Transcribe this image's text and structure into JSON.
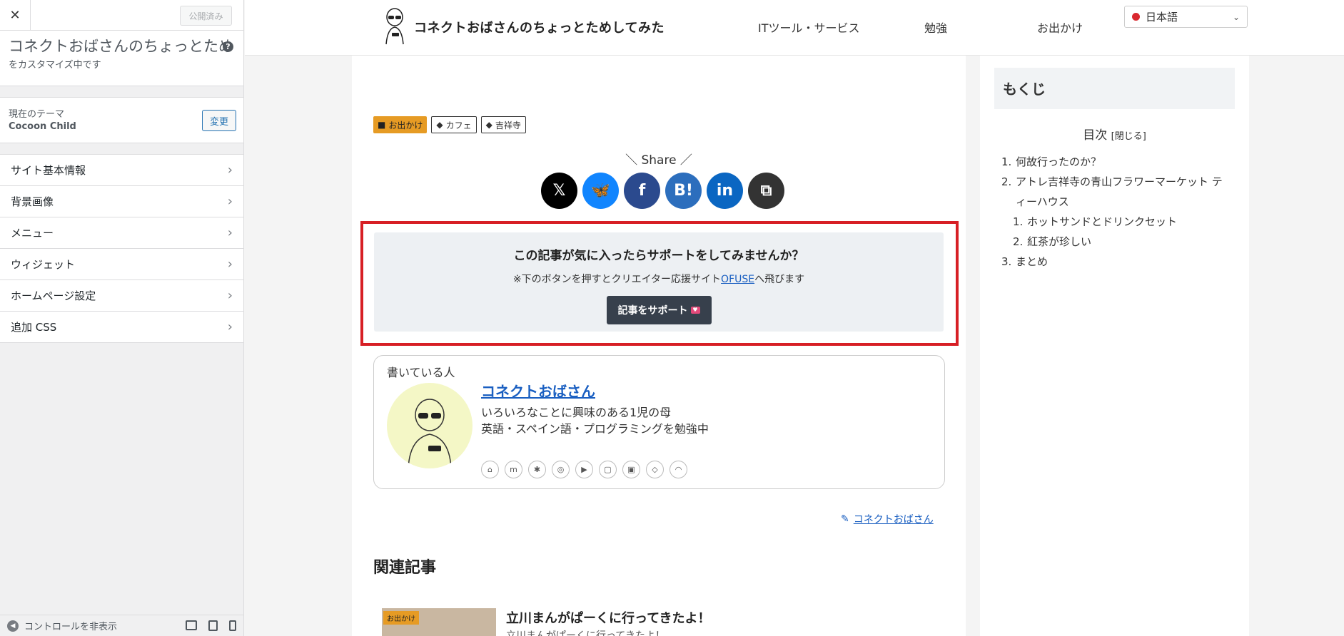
{
  "customizer": {
    "close_glyph": "✕",
    "publish_label": "公開済み",
    "site_title": "コネクトおばさんのちょっとため…",
    "subtitle": "をカスタマイズ中です",
    "help_glyph": "?",
    "theme_label": "現在のテーマ",
    "theme_name": "Cocoon Child",
    "change_label": "変更",
    "menu": [
      {
        "label": "サイト基本情報"
      },
      {
        "label": "背景画像"
      },
      {
        "label": "メニュー"
      },
      {
        "label": "ウィジェット"
      },
      {
        "label": "ホームページ設定"
      },
      {
        "label": "追加 CSS"
      }
    ],
    "hide_controls_label": "コントロールを非表示"
  },
  "header": {
    "site_title": "コネクトおばさんのちょっとためしてみた",
    "nav": [
      "ITツール・サービス",
      "勉強",
      "お出かけ"
    ],
    "language": "日本語"
  },
  "article": {
    "categories": [
      {
        "label": "お出かけ",
        "type": "folder"
      },
      {
        "label": "カフェ",
        "type": "tag"
      },
      {
        "label": "吉祥寺",
        "type": "tag"
      }
    ],
    "share_label": "＼ Share ／",
    "share_buttons": [
      {
        "name": "x",
        "glyph": "𝕏",
        "color": "#000000"
      },
      {
        "name": "bluesky",
        "glyph": "🦋",
        "color": "#1185fe"
      },
      {
        "name": "facebook",
        "glyph": "f",
        "color": "#2b4a8e"
      },
      {
        "name": "hatena",
        "glyph": "B!",
        "color": "#2c6ebd"
      },
      {
        "name": "linkedin",
        "glyph": "in",
        "color": "#0a66c2"
      },
      {
        "name": "copy",
        "glyph": "⧉",
        "color": "#333333"
      }
    ],
    "support": {
      "title": "この記事が気に入ったらサポートをしてみませんか？",
      "text_before": "※下のボタンを押すとクリエイター応援サイト",
      "link_text": "OFUSE",
      "text_after": "へ飛びます",
      "button_label": "記事をサポート",
      "highlight_color": "#d71f25"
    },
    "author": {
      "label": "書いている人",
      "name": "コネクトおばさん",
      "desc_line1": "いろいろなことに興味のある1児の母",
      "desc_line2": "英語・スペイン語・プログラミングを勉強中",
      "social_icons": [
        "home-icon",
        "mastodon-icon",
        "bluesky-icon",
        "instagram-icon",
        "youtube-icon",
        "note-icon",
        "twitch-icon",
        "feedly-icon",
        "rss-icon"
      ]
    },
    "author_link": "コネクトおばさん",
    "related_heading": "関連記事",
    "related": [
      {
        "title": "立川まんがぱーくに行ってきたよ！",
        "snippet": "立川まんがぱーくに行ってきたよ！",
        "badge": "お出かけ"
      }
    ]
  },
  "toc": {
    "heading": "もくじ",
    "title": "目次",
    "toggle": "[閉じる]",
    "items": [
      {
        "num": "1.",
        "label": "何故行ったのか？",
        "level": 1
      },
      {
        "num": "2.",
        "label": "アトレ吉祥寺の青山フラワーマーケット ティーハウス",
        "level": 1
      },
      {
        "num": "1.",
        "label": "ホットサンドとドリンクセット",
        "level": 2
      },
      {
        "num": "2.",
        "label": "紅茶が珍しい",
        "level": 2
      },
      {
        "num": "3.",
        "label": "まとめ",
        "level": 1
      }
    ]
  }
}
